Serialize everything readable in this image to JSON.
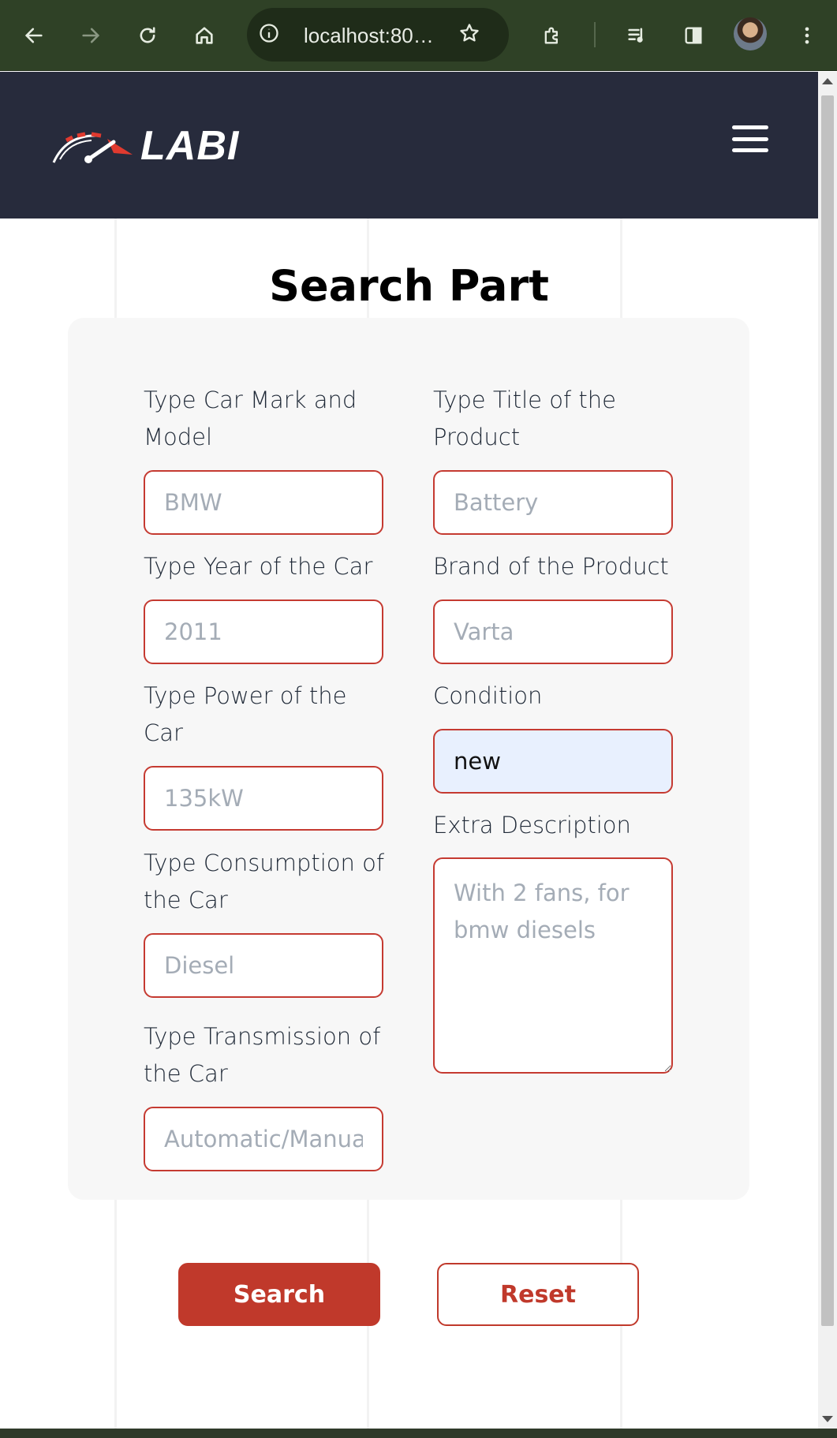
{
  "browser": {
    "url": "localhost:80…"
  },
  "site": {
    "logo_text": "LABI"
  },
  "page": {
    "title": "Search Part"
  },
  "form": {
    "car_model": {
      "label": "Type Car Mark and Model",
      "placeholder": "BMW"
    },
    "product_title": {
      "label": "Type Title of the Product",
      "placeholder": "Battery"
    },
    "car_year": {
      "label": "Type Year of the Car",
      "placeholder": "2011"
    },
    "product_brand": {
      "label": "Brand of the Product",
      "placeholder": "Varta"
    },
    "car_power": {
      "label": "Type Power of the Car",
      "placeholder": "135kW"
    },
    "condition": {
      "label": "Condition",
      "value": "new"
    },
    "car_consumption": {
      "label": "Type Consumption of the Car",
      "placeholder": "Diesel"
    },
    "extra_description": {
      "label": "Extra Description",
      "placeholder": "With 2 fans, for bmw diesels"
    },
    "car_transmission": {
      "label": "Type Transmission of the Car",
      "placeholder": "Automatic/Manual"
    }
  },
  "buttons": {
    "search": "Search",
    "reset": "Reset"
  },
  "colors": {
    "header_bg": "#272b3c",
    "accent": "#c0392b",
    "chrome_bg": "#2f4126",
    "autofill_bg": "#e8f0fe"
  }
}
